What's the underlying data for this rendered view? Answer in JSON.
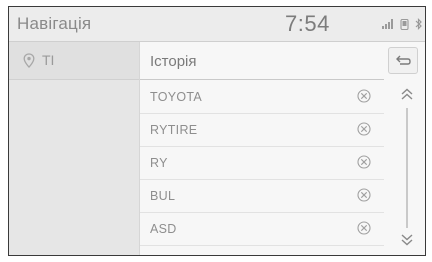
{
  "header": {
    "title": "Навігація",
    "clock": "7:54",
    "status_icons": [
      "signal-icon",
      "phone-icon",
      "bluetooth-icon"
    ]
  },
  "sidebar": {
    "items": [
      {
        "label": "TI",
        "icon": "map-pin-icon"
      }
    ]
  },
  "main": {
    "title": "Історія",
    "back_icon": "back-arrow-icon",
    "rows": [
      {
        "label": "TOYOTA"
      },
      {
        "label": "RYTIRE"
      },
      {
        "label": "RY"
      },
      {
        "label": "BUL"
      },
      {
        "label": "ASD"
      }
    ],
    "delete_icon": "delete-icon",
    "scroll_up_icon": "chevron-up-icon",
    "scroll_down_icon": "chevron-down-icon"
  },
  "colors": {
    "text": "#8e8e8e",
    "panel": "#f7f7f7",
    "sidebar": "#e6e6e6",
    "border": "#3a3a3a"
  }
}
